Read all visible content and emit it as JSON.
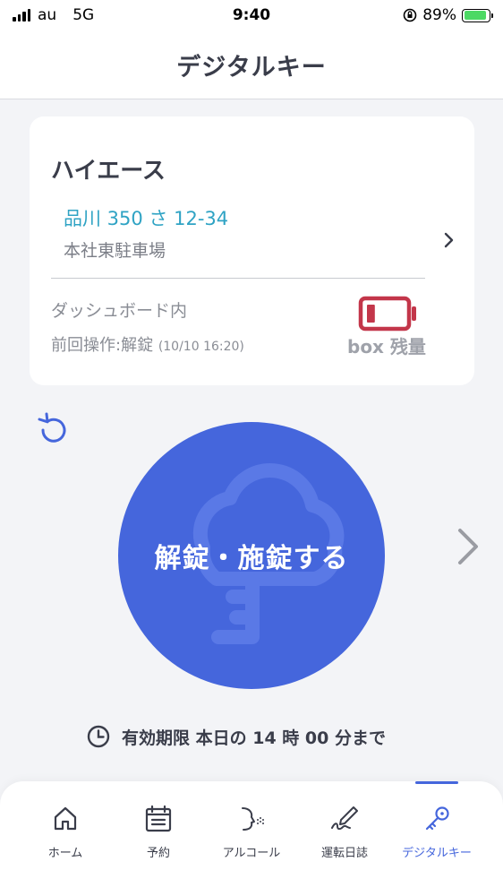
{
  "status_bar": {
    "carrier": "au",
    "network": "5G",
    "time": "9:40",
    "battery_percent": "89%",
    "battery_level": 0.89
  },
  "header": {
    "title": "デジタルキー"
  },
  "vehicle_card": {
    "name": "ハイエース",
    "plate": "品川 350 さ 12-34",
    "parking": "本社東駐車場",
    "key_location": "ダッシュボード内",
    "last_operation": "前回操作:解錠",
    "last_operation_time": "(10/10 16:20)",
    "box_level_label": "box 残量",
    "box_level": 0.2,
    "box_level_color": "#c3364a"
  },
  "main_button": {
    "label": "解錠・施錠する",
    "color": "#4566dc"
  },
  "expiry": {
    "text": "有効期限 本日の 14 時 00 分まで"
  },
  "tabbar": {
    "active_index": 4,
    "accent_color": "#4566dc",
    "tabs": [
      {
        "label": "ホーム",
        "icon": "home-icon"
      },
      {
        "label": "予約",
        "icon": "calendar-icon"
      },
      {
        "label": "アルコール",
        "icon": "breath-icon"
      },
      {
        "label": "運転日誌",
        "icon": "pen-icon"
      },
      {
        "label": "デジタルキー",
        "icon": "key-icon"
      }
    ]
  }
}
